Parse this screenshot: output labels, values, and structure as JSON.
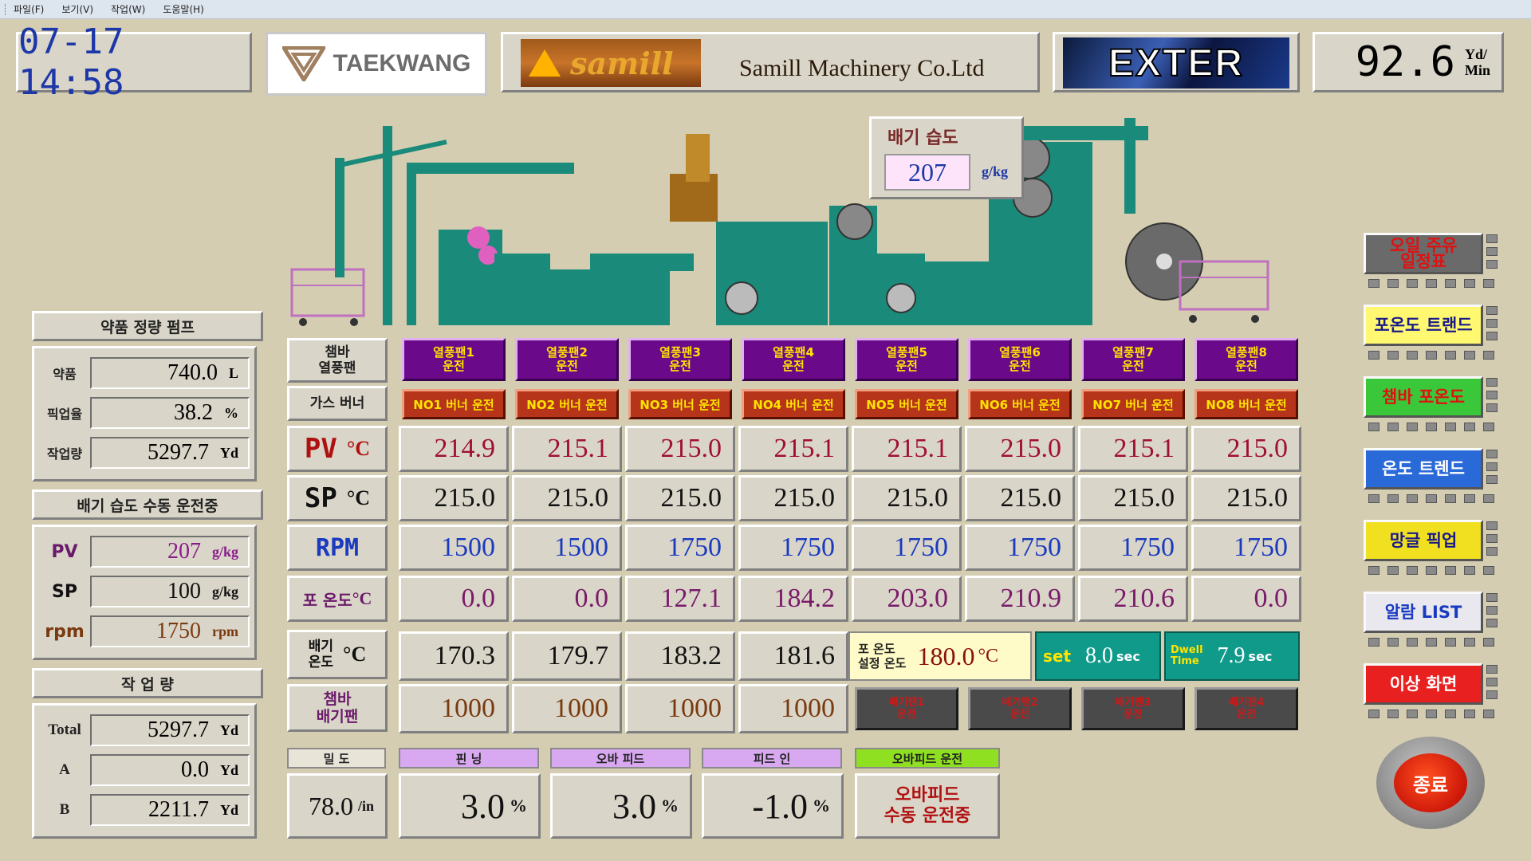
{
  "menu": [
    "파일(F)",
    "보기(V)",
    "작업(W)",
    "도움말(H)"
  ],
  "header": {
    "datetime": "07-17  14:58",
    "taekwang": "TAEKWANG",
    "samill_mark": "samill",
    "samill_company": "Samill Machinery Co.Ltd",
    "exter": "EXTER",
    "speed_value": "92.6",
    "speed_unit_top": "Yd/",
    "speed_unit_bottom": "Min"
  },
  "exhaust_humidity": {
    "title": "배기 습도",
    "value": "207",
    "unit": "g/kg"
  },
  "chem_pump": {
    "title": "약품 정량 펌프",
    "rows": [
      {
        "label": "약품",
        "value": "740.0",
        "unit": "L"
      },
      {
        "label": "픽업율",
        "value": "38.2",
        "unit": "%"
      },
      {
        "label": "작업량",
        "value": "5297.7",
        "unit": "Yd"
      }
    ]
  },
  "humidity_manual": {
    "title": "배기 습도 수동 운전중",
    "rows": [
      {
        "label": "PV",
        "value": "207",
        "unit": "g/kg"
      },
      {
        "label": "SP",
        "value": "100",
        "unit": "g/kg"
      },
      {
        "label": "rpm",
        "value": "1750",
        "unit": "rpm"
      }
    ]
  },
  "workload": {
    "title": "작 업 량",
    "rows": [
      {
        "label": "Total",
        "value": "5297.7",
        "unit": "Yd"
      },
      {
        "label": "A",
        "value": "0.0",
        "unit": "Yd"
      },
      {
        "label": "B",
        "value": "2211.7",
        "unit": "Yd"
      }
    ]
  },
  "grid": {
    "fan_header": "챔바\n열풍팬",
    "burner_header": "가스 버너",
    "pv_label": "PV",
    "sp_label": "SP",
    "rpm_label": "RPM",
    "fab_label": "포 온도",
    "exhaust_label": "배기\n온도",
    "chamber_fan_label": "챔바\n배기팬",
    "deg_unit": "°C",
    "fans": [
      "열풍팬1\n운전",
      "열풍팬2\n운전",
      "열풍팬3\n운전",
      "열풍팬4\n운전",
      "열풍팬5\n운전",
      "열풍팬6\n운전",
      "열풍팬7\n운전",
      "열풍팬8\n운전"
    ],
    "burners": [
      "NO1 버너 운전",
      "NO2 버너 운전",
      "NO3 버너 운전",
      "NO4 버너 운전",
      "NO5 버너 운전",
      "NO6 버너 운전",
      "NO7 버너 운전",
      "NO8 버너 운전"
    ],
    "pv": [
      "214.9",
      "215.1",
      "215.0",
      "215.1",
      "215.1",
      "215.0",
      "215.1",
      "215.0"
    ],
    "sp": [
      "215.0",
      "215.0",
      "215.0",
      "215.0",
      "215.0",
      "215.0",
      "215.0",
      "215.0"
    ],
    "rpm": [
      "1500",
      "1500",
      "1750",
      "1750",
      "1750",
      "1750",
      "1750",
      "1750"
    ],
    "fabric": [
      "0.0",
      "0.0",
      "127.1",
      "184.2",
      "203.0",
      "210.9",
      "210.6",
      "0.0"
    ],
    "exhaust": [
      "170.3",
      "179.7",
      "183.2",
      "181.6"
    ],
    "chamber_fan": [
      "1000",
      "1000",
      "1000",
      "1000"
    ],
    "chamber_fan_btns": [
      "배기팬1\n운전",
      "배기팬2\n운전",
      "배기팬3\n운전",
      "배기팬4\n운전"
    ]
  },
  "setpoints": {
    "fab_set_label": "포 온도\n설정 온도",
    "fab_set_value": "180.0",
    "fab_set_unit": "°C",
    "set_label": "set",
    "set_value": "8.0",
    "set_unit": "sec",
    "dwell_label": "Dwell\nTime",
    "dwell_value": "7.9",
    "dwell_unit": "sec"
  },
  "bottom": {
    "density_label": "밀 도",
    "density_value": "78.0",
    "density_unit": "/in",
    "pinning_label": "핀 닝",
    "pinning_value": "3.0",
    "overfeed_label": "오바 피드",
    "overfeed_value": "3.0",
    "feedin_label": "피드 인",
    "feedin_value": "-1.0",
    "pct": "%",
    "overfeed_run_label": "오바피드 운전",
    "overfeed_manual": "오바피드\n수동 운전중"
  },
  "side_buttons": [
    {
      "label": "오일 주유\n일정표",
      "bg": "#6a6a6a",
      "fg": "#e01010"
    },
    {
      "label": "포온도 트랜드",
      "bg": "#fff870",
      "fg": "#1a1a8a"
    },
    {
      "label": "챔바 포온도",
      "bg": "#3ac83a",
      "fg": "#e01010"
    },
    {
      "label": "온도 트렌드",
      "bg": "#2a6ad8",
      "fg": "#ffffff"
    },
    {
      "label": "망글 픽업",
      "bg": "#f0e020",
      "fg": "#1a1a8a"
    },
    {
      "label": "알람 LIST",
      "bg": "#e8e8ee",
      "fg": "#1a3ac0"
    },
    {
      "label": "이상 화면",
      "bg": "#e82020",
      "fg": "#ffffff"
    }
  ],
  "stop_label": "종료",
  "colors": {
    "background": "#d4cdb1",
    "fan_button": "#6a0a8a",
    "burner_button": "#b5341a",
    "machine": "#1a8a7a"
  }
}
